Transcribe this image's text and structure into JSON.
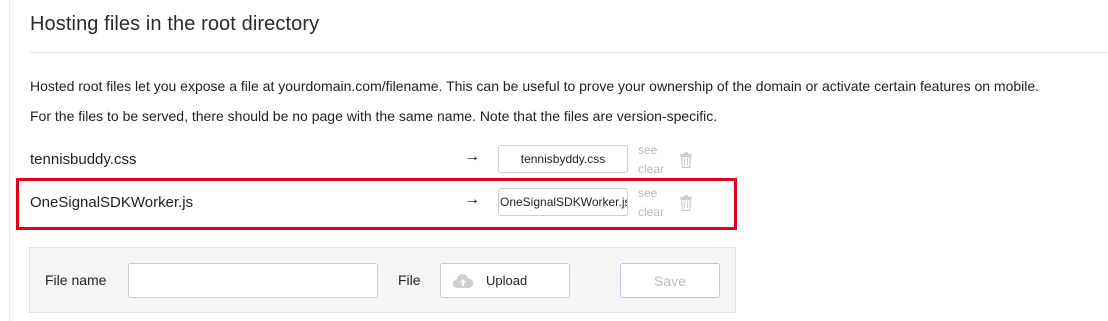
{
  "section": {
    "title": "Hosting files in the root directory",
    "description_1": "Hosted root files let you expose a file at yourdomain.com/filename. This can be useful to prove your ownership of the domain or activate certain features on mobile.",
    "description_2": "For the files to be served, there should be no page with the same name. Note that the files are version-specific."
  },
  "files": [
    {
      "name": "tennisbuddy.css",
      "arrow": "→",
      "target": "tennisbyddy.css",
      "see_label": "see",
      "clear_label": "clear",
      "icon": "trash-icon"
    },
    {
      "name": "OneSignalSDKWorker.js",
      "arrow": "→",
      "target": "OneSignalSDKWorker.js",
      "see_label": "see",
      "clear_label": "clear",
      "icon": "trash-icon"
    }
  ],
  "highlight": {
    "color": "#e1001b",
    "target_row": 1
  },
  "add_form": {
    "file_name_label": "File name",
    "file_name_value": "",
    "file_label": "File",
    "upload_label": "Upload",
    "upload_icon": "cloud-upload-icon",
    "save_label": "Save",
    "save_enabled": false
  }
}
